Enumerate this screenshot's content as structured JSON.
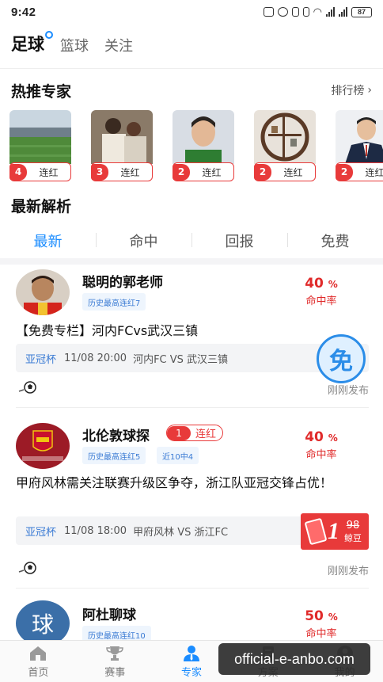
{
  "status": {
    "time": "9:42",
    "battery": "87"
  },
  "sport_tabs": [
    {
      "label": "足球",
      "active": true
    },
    {
      "label": "篮球",
      "active": false
    },
    {
      "label": "关注",
      "active": false
    }
  ],
  "hot_experts": {
    "title": "热推专家",
    "rank_link": "排行榜",
    "items": [
      {
        "streak": "4",
        "label": "连红",
        "photo": "stadium-photo"
      },
      {
        "streak": "3",
        "label": "连红",
        "photo": "players-photo"
      },
      {
        "streak": "2",
        "label": "连红",
        "photo": "goalkeeper-photo"
      },
      {
        "streak": "2",
        "label": "连红",
        "photo": "shelf-photo"
      },
      {
        "streak": "2",
        "label": "连红",
        "photo": "man-in-suit-photo"
      }
    ]
  },
  "latest": {
    "title": "最新解析",
    "tabs": [
      {
        "label": "最新",
        "active": true
      },
      {
        "label": "命中",
        "active": false
      },
      {
        "label": "回报",
        "active": false
      },
      {
        "label": "免费",
        "active": false
      }
    ]
  },
  "articles": [
    {
      "author": "聪明的郭老师",
      "tags": [
        "历史最高连红7"
      ],
      "streak": null,
      "hit_rate": "40",
      "hit_unit": "%",
      "hit_label": "命中率",
      "headline": "【免费专栏】河内FCvs武汉三镇",
      "league": "亚冠杯",
      "match_time": "11/08 20:00",
      "match": "河内FC VS 武汉三镇",
      "price_type": "free",
      "free_char": "免",
      "published": "刚刚发布"
    },
    {
      "author": "北伦敦球探",
      "tags": [
        "历史最高连红5",
        "近10中4"
      ],
      "streak": {
        "num": "1",
        "label": "连红"
      },
      "hit_rate": "40",
      "hit_unit": "%",
      "hit_label": "命中率",
      "headline": "甲府风林需关注联赛升级区争夺，浙江队亚冠交锋占优！",
      "league": "亚冠杯",
      "match_time": "11/08 18:00",
      "match": "甲府风林 VS 浙江FC",
      "price_type": "paid",
      "price": "1",
      "old_price": "98",
      "currency": "鲸豆",
      "published": "刚刚发布"
    },
    {
      "author": "阿杜聊球",
      "avatar_char": "球",
      "tags": [
        "历史最高连红10"
      ],
      "hit_rate": "50",
      "hit_unit": "%",
      "hit_label": "命中率"
    }
  ],
  "bottom_nav": [
    {
      "label": "首页",
      "icon": "home-icon",
      "active": false
    },
    {
      "label": "赛事",
      "icon": "trophy-icon",
      "active": false
    },
    {
      "label": "专家",
      "icon": "expert-icon",
      "active": true
    },
    {
      "label": "方案",
      "icon": "plan-icon",
      "active": false
    },
    {
      "label": "我的",
      "icon": "profile-icon",
      "active": false
    }
  ],
  "watermark": "official-e-anbo.com",
  "colors": {
    "accent_blue": "#1a8cff",
    "streak_red": "#e83a3a",
    "rate_red": "#e02a2a",
    "tag_blue": "#3b7bd4"
  }
}
